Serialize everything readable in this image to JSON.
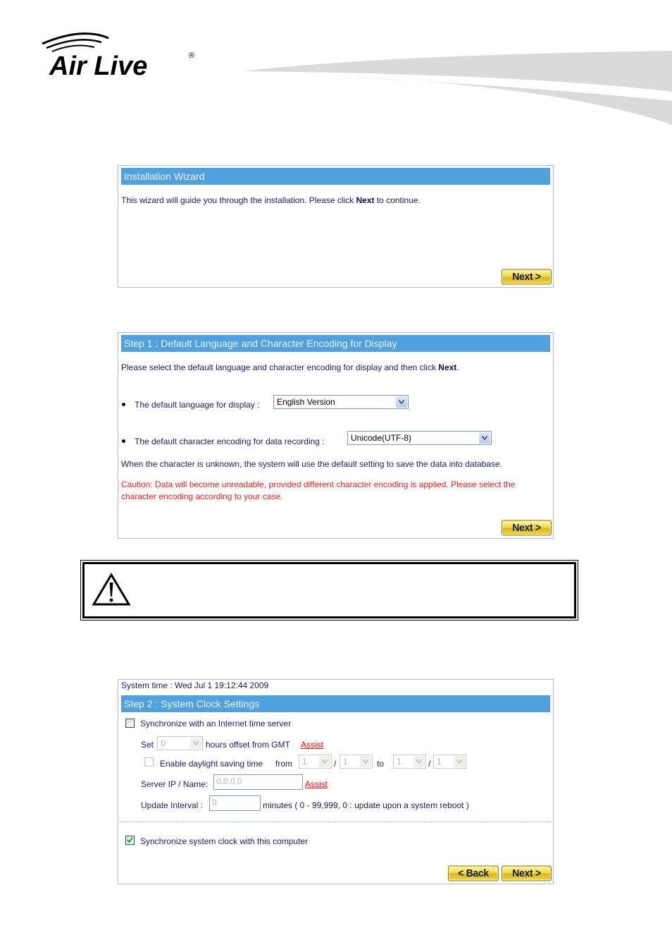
{
  "brand": {
    "name": "Air Live",
    "registered_mark": "®"
  },
  "colors": {
    "title_bar": "#52a1df",
    "body_text": "#1a1a6e",
    "caution_text": "#ff1a1a",
    "link": "#ff0000",
    "button_gold": "#f3d94a"
  },
  "wizard": {
    "title": "Installation Wizard",
    "intro_pre": "This wizard will guide you through the installation. Please click ",
    "intro_bold": "Next",
    "intro_post": " to continue.",
    "next_label": "Next >"
  },
  "step1": {
    "title": "Step 1 : Default Language and Character Encoding for Display",
    "intro_pre": "Please select the default language and character encoding for display and then click ",
    "intro_bold": "Next",
    "intro_post": ".",
    "language_label": "The default language for display :",
    "language_value": "English Version",
    "encoding_label": "The default character encoding for data recording :",
    "encoding_value": "Unicode(UTF-8)",
    "unknown_note": "When the character is unknown, the system will use the default setting to save the data into database.",
    "caution": "Caution: Data will become unreadable, provided different character encoding is applied. Please select the character encoding according to your case.",
    "next_label": "Next >"
  },
  "warning": {
    "icon": "warning-triangle-icon",
    "text": ""
  },
  "step2": {
    "system_time": "System time : Wed Jul 1 19:12:44 2009",
    "title": "Step 2 : System Clock Settings",
    "sync_internet_label": "Synchronize with an Internet time server",
    "sync_internet_checked": false,
    "set_label": "Set",
    "gmt_offset_value": "0",
    "gmt_offset_suffix": "hours offset from GMT",
    "assist_label": "Assist",
    "dst_label": "Enable daylight saving time",
    "dst_checked": false,
    "from_label": "from",
    "to_label": "to",
    "slash": "/",
    "dst_from_month": "1",
    "dst_from_day": "1",
    "dst_to_month": "1",
    "dst_to_day": "1",
    "server_label": "Server IP / Name:",
    "server_value": "0.0.0.0",
    "interval_label": "Update Interval :",
    "interval_value": "0",
    "interval_hint": "minutes ( 0 - 99,999, 0 : update upon a system reboot )",
    "sync_computer_label": "Synchronize system clock with this computer",
    "sync_computer_checked": true,
    "back_label": "< Back",
    "next_label": "Next >"
  }
}
